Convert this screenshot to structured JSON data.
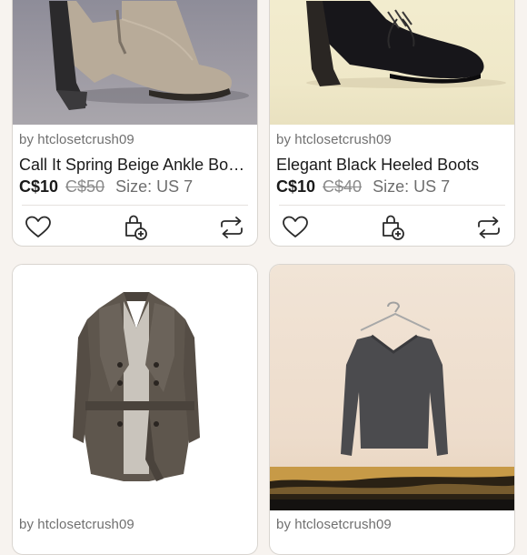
{
  "listings": [
    {
      "seller": "by htclosetcrush09",
      "title": "Call It Spring Beige Ankle Bo…",
      "price": "C$10",
      "original_price": "C$50",
      "size": "Size: US 7",
      "image": "beige-heeled-ankle-boot"
    },
    {
      "seller": "by htclosetcrush09",
      "title": "Elegant Black Heeled Boots",
      "price": "C$10",
      "original_price": "C$40",
      "size": "Size: US 7",
      "image": "black-suede-heeled-boot"
    },
    {
      "seller": "by htclosetcrush09",
      "image": "brown-tweed-peacoat"
    },
    {
      "seller": "by htclosetcrush09",
      "image": "charcoal-v-neck-sweater"
    }
  ],
  "icons": {
    "like": "heart-icon",
    "bundle": "bag-plus-icon",
    "share": "share-icon"
  },
  "colors": {
    "background": "#f7f3ef",
    "card": "#ffffff",
    "text": "#1a1a1a",
    "muted": "#707070"
  }
}
